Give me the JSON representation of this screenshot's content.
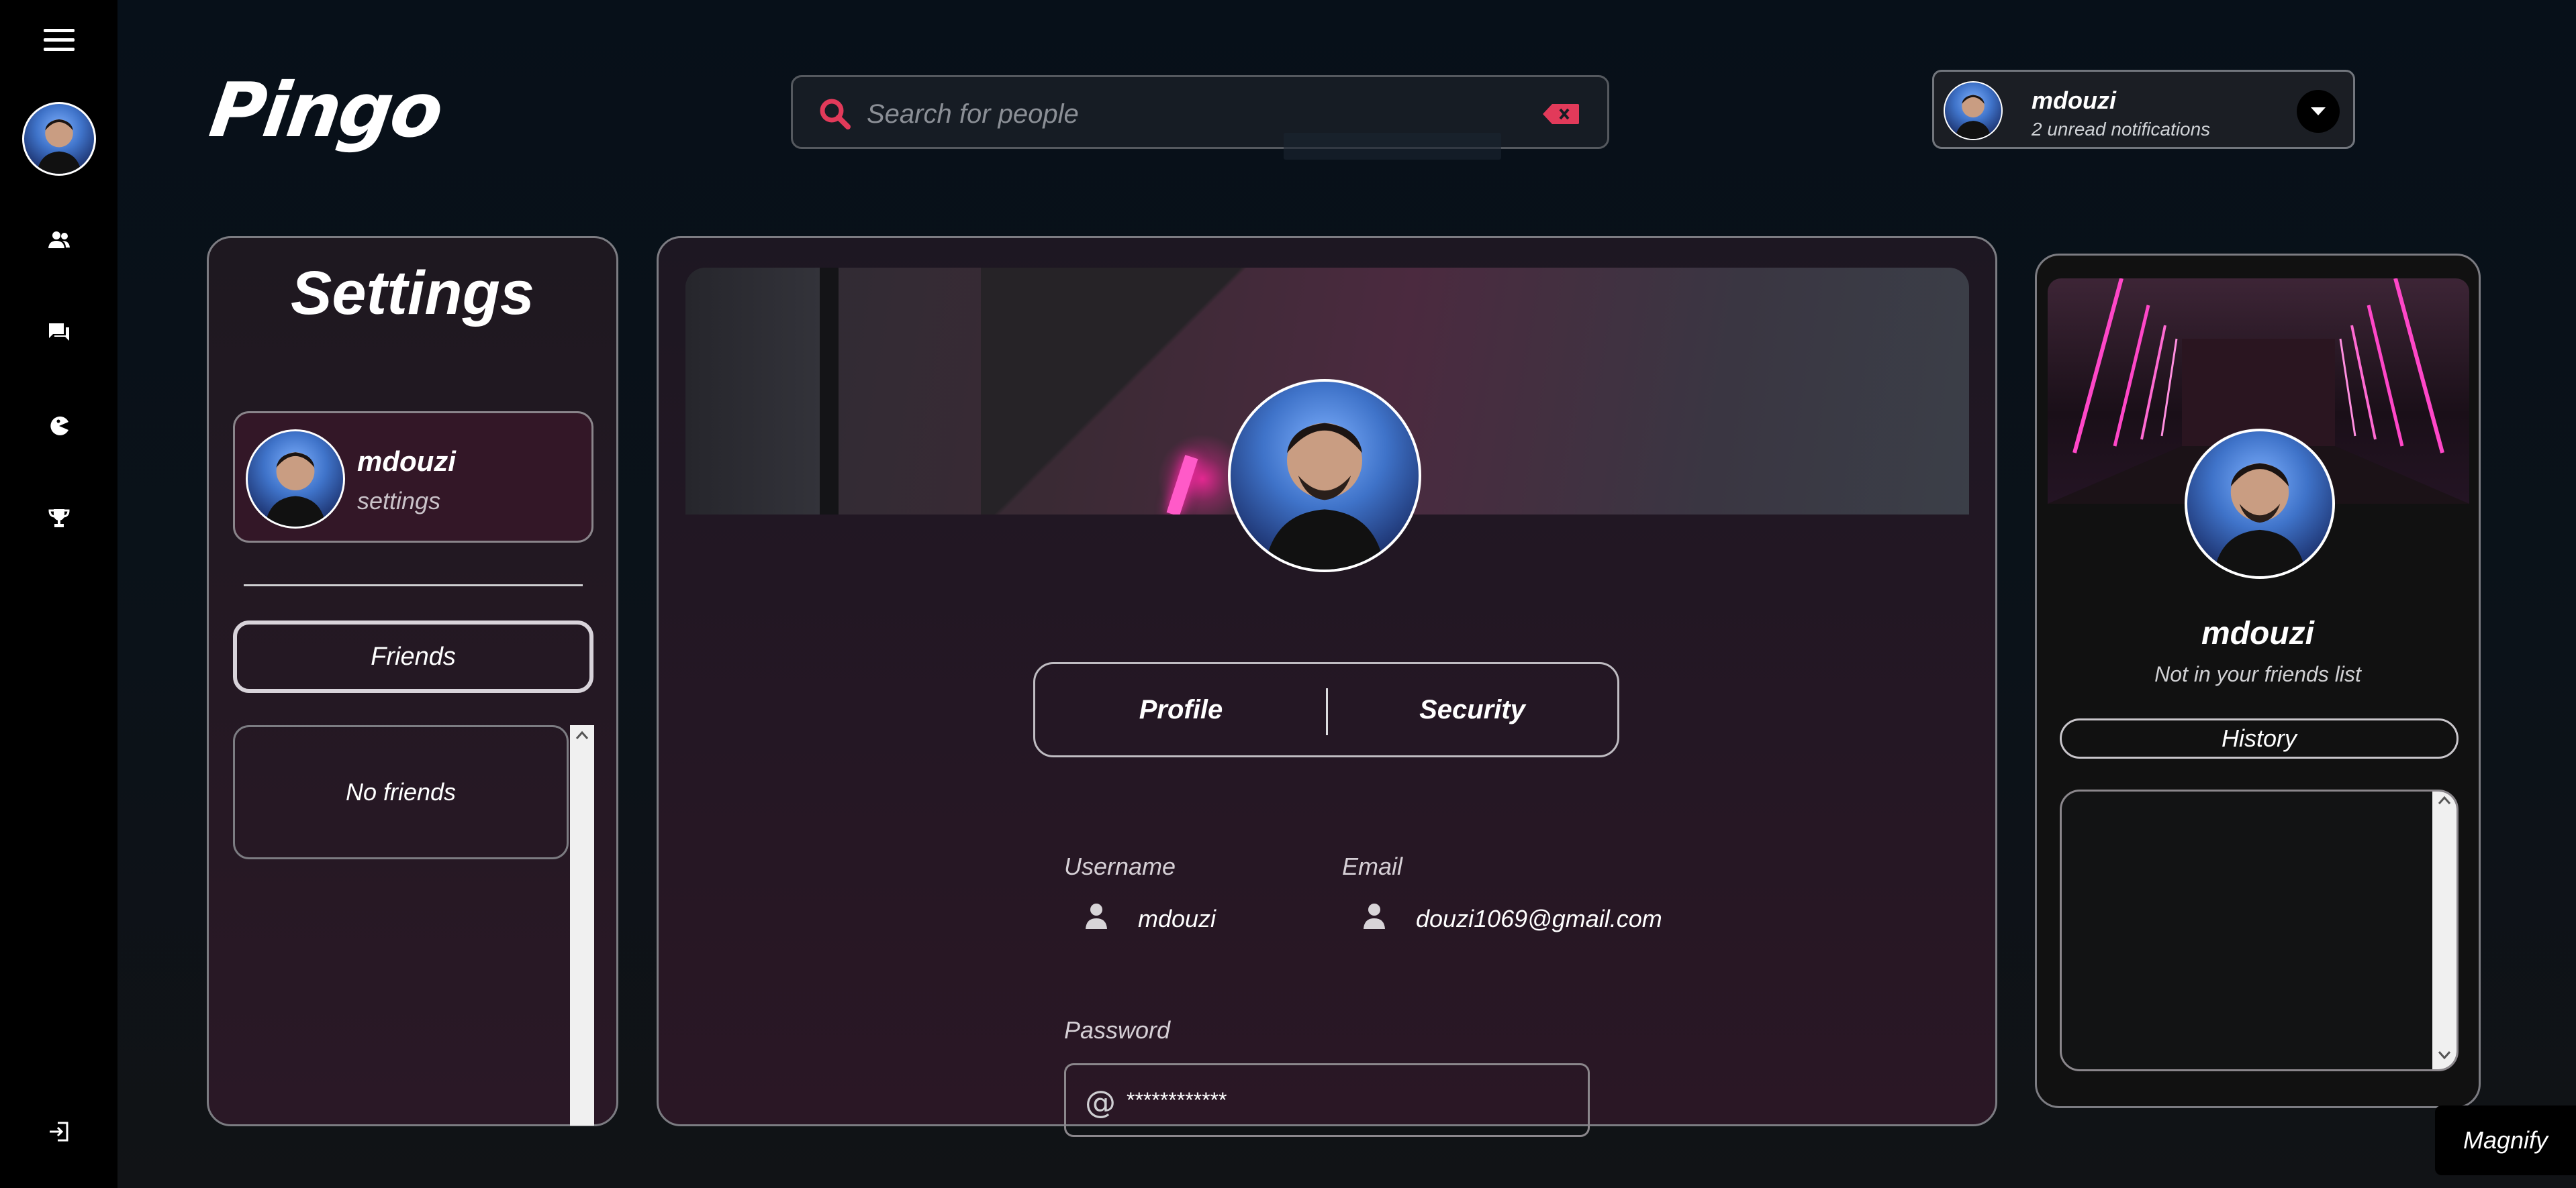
{
  "app": {
    "logo": "Pingo"
  },
  "search": {
    "placeholder": "Search for people",
    "value": ""
  },
  "user": {
    "name": "mdouzi",
    "notifications": "2 unread notifications"
  },
  "sidebar": {
    "items": [
      {
        "icon": "menu-icon"
      },
      {
        "icon": "avatar"
      },
      {
        "icon": "friends-icon"
      },
      {
        "icon": "chat-icon"
      },
      {
        "icon": "game-icon"
      },
      {
        "icon": "trophy-icon"
      },
      {
        "icon": "logout-icon"
      }
    ]
  },
  "settings": {
    "title": "Settings",
    "profile_card": {
      "name": "mdouzi",
      "sub": "settings"
    },
    "friends_button": "Friends",
    "friends_empty": "No friends"
  },
  "profile": {
    "tabs": [
      {
        "label": "Profile"
      },
      {
        "label": "Security"
      }
    ],
    "username_label": "Username",
    "username_value": "mdouzi",
    "email_label": "Email",
    "email_value": "douzi1069@gmail.com",
    "password_label": "Password",
    "password_value": "************"
  },
  "right_panel": {
    "name": "mdouzi",
    "status": "Not in your friends list",
    "history_button": "History"
  },
  "magnify": {
    "label": "Magnify"
  },
  "colors": {
    "accent": "#e23a5a",
    "panel": "#2a1826",
    "neon": "#ff2aa9"
  }
}
